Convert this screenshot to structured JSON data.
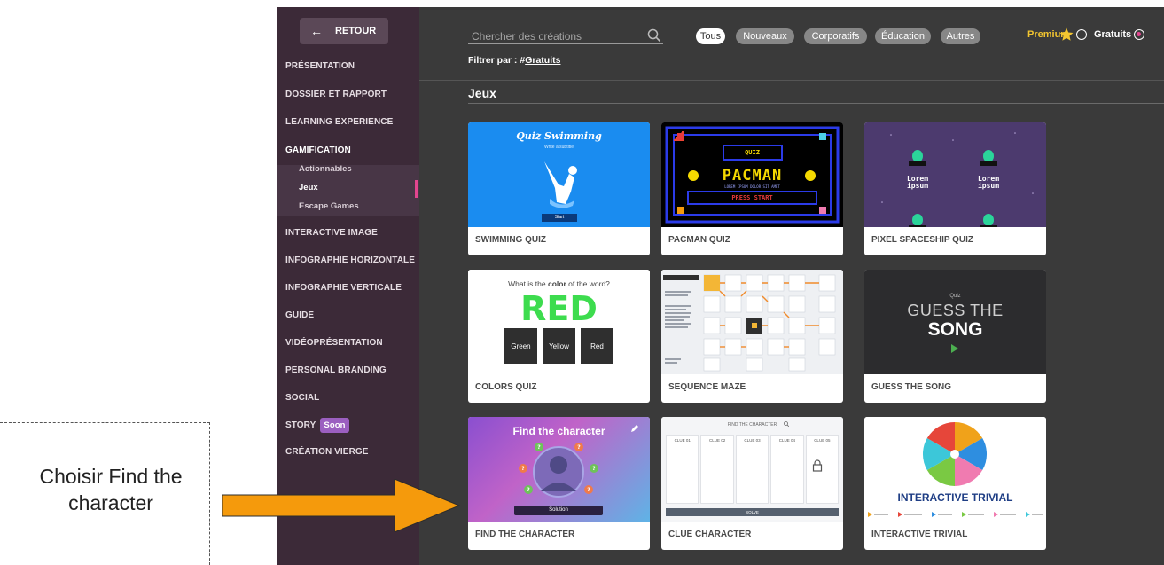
{
  "sidebar": {
    "back_label": "RETOUR",
    "items": [
      {
        "label": "PRÉSENTATION"
      },
      {
        "label": "DOSSIER ET RAPPORT"
      },
      {
        "label": "LEARNING EXPERIENCE"
      },
      {
        "label": "GAMIFICATION"
      },
      {
        "label": "INTERACTIVE IMAGE"
      },
      {
        "label": "INFOGRAPHIE HORIZONTALE"
      },
      {
        "label": "INFOGRAPHIE VERTICALE"
      },
      {
        "label": "GUIDE"
      },
      {
        "label": "VIDÉOPRÉSENTATION"
      },
      {
        "label": "PERSONAL BRANDING"
      },
      {
        "label": "SOCIAL"
      },
      {
        "label": "STORY"
      },
      {
        "label": "CRÉATION VIERGE"
      }
    ],
    "sub_items": [
      {
        "label": "Actionnables"
      },
      {
        "label": "Jeux"
      },
      {
        "label": "Escape Games"
      }
    ],
    "soon_badge": "Soon"
  },
  "search": {
    "placeholder": "Chercher des créations"
  },
  "filters": [
    {
      "label": "Tous",
      "selected": true
    },
    {
      "label": "Nouveaux"
    },
    {
      "label": "Corporatifs"
    },
    {
      "label": "Éducation"
    },
    {
      "label": "Autres"
    }
  ],
  "filter_line": {
    "prefix": "Filtrer par : #",
    "tag": "Gratuits"
  },
  "premium_label": "Premium",
  "gratuits_label": "Gratuits",
  "section_title": "Jeux",
  "cards": [
    {
      "label": "SWIMMING QUIZ",
      "thumb_title": "Quiz Swimming",
      "thumb_sub": "Write a subtitle",
      "thumb_btn": "Start"
    },
    {
      "label": "PACMAN QUIZ",
      "thumb_quiz": "QUIZ",
      "thumb_title": "PACMAN",
      "thumb_sub": "LOREM IPSUM DOLOR SIT AMET",
      "thumb_press": "PRESS START"
    },
    {
      "label": "PIXEL SPACESHIP QUIZ",
      "thumb_text_a": "Lorem ipsum",
      "thumb_text_b": "Lorem ipsum"
    },
    {
      "label": "COLORS QUIZ",
      "thumb_q_a": "What is the ",
      "thumb_q_b": "color",
      "thumb_q_c": " of the word?",
      "thumb_word": "RED",
      "thumb_opts": [
        "Green",
        "Yellow",
        "Red"
      ]
    },
    {
      "label": "SEQUENCE MAZE"
    },
    {
      "label": "GUESS THE SONG",
      "thumb_small": "Quiz",
      "thumb_a": "GUESS THE",
      "thumb_b": "SONG"
    },
    {
      "label": "FIND THE CHARACTER",
      "thumb_title": "Find the character",
      "thumb_btn": "Solution"
    },
    {
      "label": "CLUE CHARACTER",
      "thumb_title": "FIND THE CHARACTER",
      "thumb_cols": [
        "CLUE 01",
        "CLUE 02",
        "CLUE 03",
        "CLUE 04",
        "CLUE 05"
      ],
      "thumb_btn": "SOLVE"
    },
    {
      "label": "INTERACTIVE TRIVIAL",
      "thumb_title": "INTERACTIVE TRIVIAL"
    }
  ],
  "callout": {
    "text": "Choisir Find the character"
  },
  "colors": {
    "sidebar_bg": "#3c2a38",
    "main_bg": "#3a3a3a",
    "accent_pink": "#e2468f",
    "premium_gold": "#f2c530",
    "arrow_orange": "#f59a0c"
  }
}
